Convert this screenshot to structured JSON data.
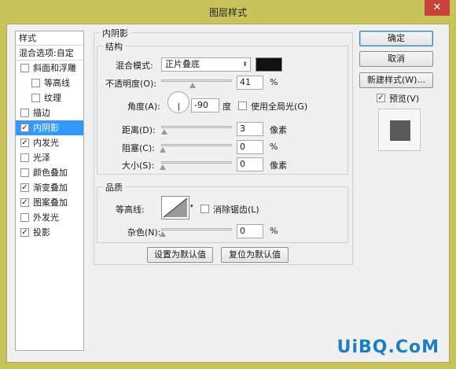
{
  "window": {
    "title": "图层样式",
    "close_glyph": "✕"
  },
  "stylelist": {
    "header": "样式",
    "blend": "混合选项:自定",
    "items": [
      {
        "label": "斜面和浮雕",
        "checked": false,
        "sub": false,
        "selected": false
      },
      {
        "label": "等高线",
        "checked": false,
        "sub": true,
        "selected": false
      },
      {
        "label": "纹理",
        "checked": false,
        "sub": true,
        "selected": false
      },
      {
        "label": "描边",
        "checked": false,
        "sub": false,
        "selected": false
      },
      {
        "label": "内阴影",
        "checked": true,
        "sub": false,
        "selected": true
      },
      {
        "label": "内发光",
        "checked": true,
        "sub": false,
        "selected": false
      },
      {
        "label": "光泽",
        "checked": false,
        "sub": false,
        "selected": false
      },
      {
        "label": "颜色叠加",
        "checked": false,
        "sub": false,
        "selected": false
      },
      {
        "label": "渐变叠加",
        "checked": true,
        "sub": false,
        "selected": false
      },
      {
        "label": "图案叠加",
        "checked": true,
        "sub": false,
        "selected": false
      },
      {
        "label": "外发光",
        "checked": false,
        "sub": false,
        "selected": false
      },
      {
        "label": "投影",
        "checked": true,
        "sub": false,
        "selected": false
      }
    ]
  },
  "inner_shadow": {
    "section_title": "内阴影",
    "structure": {
      "title": "结构",
      "blend_mode_label": "混合模式:",
      "blend_mode_value": "正片叠底",
      "shadow_color": "#111111",
      "opacity_label": "不透明度(O):",
      "opacity_value": "41",
      "opacity_unit": "%",
      "angle_label": "角度(A):",
      "angle_value": "-90",
      "angle_unit": "度",
      "global_light_label": "使用全局光(G)",
      "distance_label": "距离(D):",
      "distance_value": "3",
      "distance_unit": "像素",
      "choke_label": "阻塞(C):",
      "choke_value": "0",
      "choke_unit": "%",
      "size_label": "大小(S):",
      "size_value": "0",
      "size_unit": "像素"
    },
    "quality": {
      "title": "品质",
      "contour_label": "等高线:",
      "antialias_label": "消除锯齿(L)",
      "noise_label": "杂色(N):",
      "noise_value": "0",
      "noise_unit": "%"
    },
    "make_default": "设置为默认值",
    "reset_default": "复位为默认值"
  },
  "actions": {
    "ok": "确定",
    "cancel": "取消",
    "new_style": "新建样式(W)...",
    "preview_label": "预览(V)",
    "preview_checked": true
  },
  "watermark": "UiBQ.CoM"
}
